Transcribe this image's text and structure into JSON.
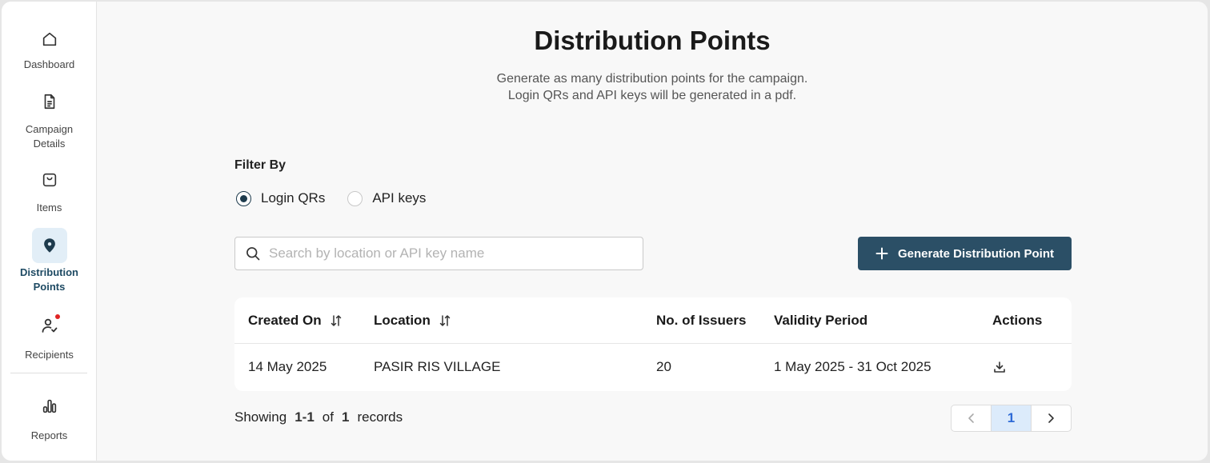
{
  "sidebar": {
    "items": [
      {
        "label": "Dashboard",
        "icon": "home-icon"
      },
      {
        "label": "Campaign\nDetails",
        "icon": "document-icon"
      },
      {
        "label": "Items",
        "icon": "shopping-bag-icon"
      },
      {
        "label": "Distribution\nPoints",
        "icon": "map-pin-icon",
        "active": true
      },
      {
        "label": "Recipients",
        "icon": "user-check-icon",
        "badge": true
      },
      {
        "label": "Reports",
        "icon": "bar-chart-icon"
      }
    ]
  },
  "page": {
    "title": "Distribution Points",
    "subtitle_line1": "Generate as many distribution points for the campaign.",
    "subtitle_line2": "Login QRs and API keys will be generated in a pdf."
  },
  "filter": {
    "label": "Filter By",
    "options": [
      {
        "label": "Login QRs",
        "checked": true
      },
      {
        "label": "API keys",
        "checked": false
      }
    ]
  },
  "search": {
    "placeholder": "Search by location or API key name",
    "value": ""
  },
  "generate_button": {
    "label": "Generate Distribution Point"
  },
  "table": {
    "columns": [
      "Created On",
      "Location",
      "No. of Issuers",
      "Validity Period",
      "Actions"
    ],
    "rows": [
      {
        "created_on": "14 May 2025",
        "location": "PASIR RIS VILLAGE",
        "issuers": "20",
        "validity": "1 May 2025 - 31 Oct 2025",
        "action_icon": "download-icon"
      }
    ]
  },
  "pagination": {
    "showing_label": "Showing",
    "range": "1-1",
    "of_label": "of",
    "total": "1",
    "records_label": "records",
    "current_page": "1"
  },
  "colors": {
    "primary": "#2b4f66",
    "active_nav_bg": "#e2eef7",
    "link": "#2f6bd6",
    "badge": "#e02424"
  }
}
